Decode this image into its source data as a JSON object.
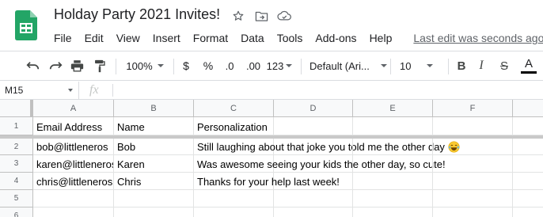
{
  "app": {
    "title": "Holday Party 2021 Invites!",
    "last_edit": "Last edit was seconds ago",
    "colors": {
      "brand_green": "#23a566",
      "text": "#202124",
      "muted": "#5f6368"
    }
  },
  "title_icons": [
    "star-icon",
    "move-to-folder-icon",
    "cloud-status-icon"
  ],
  "menu": [
    "File",
    "Edit",
    "View",
    "Insert",
    "Format",
    "Data",
    "Tools",
    "Add-ons",
    "Help"
  ],
  "toolbar": {
    "zoom": "100%",
    "currency": "$",
    "percent": "%",
    "decrease_decimals": ".0",
    "increase_decimals": ".00",
    "more_formats": "123",
    "font": "Default (Ari...",
    "font_size": "10",
    "bold": "B",
    "italic": "I",
    "strikethrough": "S",
    "text_color": "A"
  },
  "formula_bar": {
    "name_box": "M15",
    "fx": "fx",
    "value": ""
  },
  "sheet": {
    "columns": [
      "A",
      "B",
      "C",
      "D",
      "E",
      "F"
    ],
    "row_numbers": [
      "1",
      "2",
      "3",
      "4",
      "5",
      "6"
    ],
    "header_row": [
      "Email Address",
      "Name",
      "Personalization"
    ],
    "rows": [
      {
        "email": "bob@littleneros",
        "name": "Bob",
        "note": "Still laughing about that joke you told me the other day",
        "emoji": "laughing-tears-emoji"
      },
      {
        "email": "karen@littleneros",
        "name": "Karen",
        "note": "Was awesome seeing your kids the other day, so cute!"
      },
      {
        "email": "chris@littleneros",
        "name": "Chris",
        "note": "Thanks for your help last week!"
      }
    ]
  }
}
